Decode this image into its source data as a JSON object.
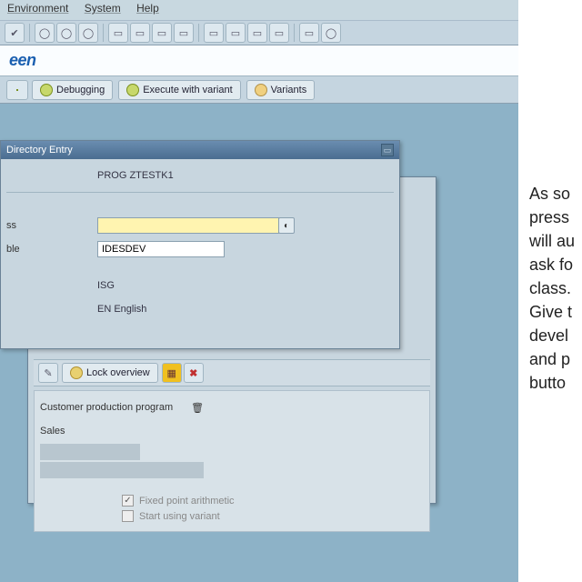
{
  "menu": {
    "item1": "Environment",
    "item2": "System",
    "item3": "Help"
  },
  "title": "een",
  "apptb": {
    "debug": "Debugging",
    "execv": "Execute with variant",
    "variants": "Variants"
  },
  "dialog": {
    "title": "Directory Entry",
    "object_label": "",
    "object_value": "PROG  ZTESTK1",
    "class_label": "ss",
    "class_value": "",
    "responsible_label": "ble",
    "responsible_value": "IDESDEV",
    "row3_label": "",
    "row3_value": "ISG",
    "lang_label": "",
    "lang_value": "EN English",
    "lock_overview": "Lock overview"
  },
  "props": {
    "header1": "Customer production program",
    "header2": "Sales",
    "fixed_point": "Fixed point arithmetic",
    "start_variant": "Start using variant"
  },
  "caption": {
    "l1": "As so",
    "l2": "press",
    "l3": "will au",
    "l4": "ask fo",
    "l5": "class.",
    "l6": "Give t",
    "l7": "devel",
    "l8": "and p",
    "l9": "butto"
  }
}
